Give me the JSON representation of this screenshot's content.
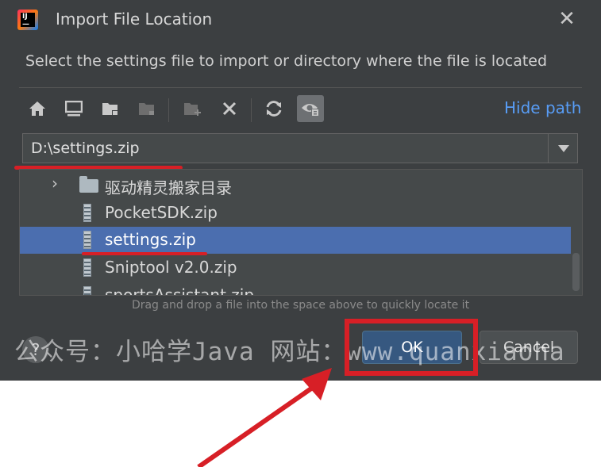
{
  "dialog": {
    "title": "Import File Location",
    "subtitle": "Select the settings file to import or directory where the file is located",
    "hide_path_label": "Hide path",
    "path_value": "D:\\settings.zip",
    "hint": "Drag and drop a file into the space above to quickly locate it",
    "ok_label": "OK",
    "cancel_label": "Cancel",
    "help_label": "?"
  },
  "toolbar": {
    "icons": [
      "home-icon",
      "desktop-icon",
      "new-folder-icon",
      "folder-disabled-icon",
      "new-folder-plus-icon",
      "delete-icon",
      "refresh-icon",
      "show-hidden-icon"
    ]
  },
  "files": [
    {
      "name": "驱动精灵搬家目录",
      "type": "folder",
      "selected": false
    },
    {
      "name": "PocketSDK.zip",
      "type": "zip",
      "selected": false
    },
    {
      "name": "settings.zip",
      "type": "zip",
      "selected": true
    },
    {
      "name": "Sniptool v2.0.zip",
      "type": "zip",
      "selected": false
    },
    {
      "name": "sportsAssistant.zip",
      "type": "zip",
      "selected": false
    }
  ],
  "watermark": {
    "text": "公众号：小哈学Java 网站：www.quanxiaoha"
  },
  "colors": {
    "dialog_bg": "#3c3f41",
    "selection": "#4b6eaf",
    "link": "#589df6",
    "annotation_red": "#d71f26"
  }
}
